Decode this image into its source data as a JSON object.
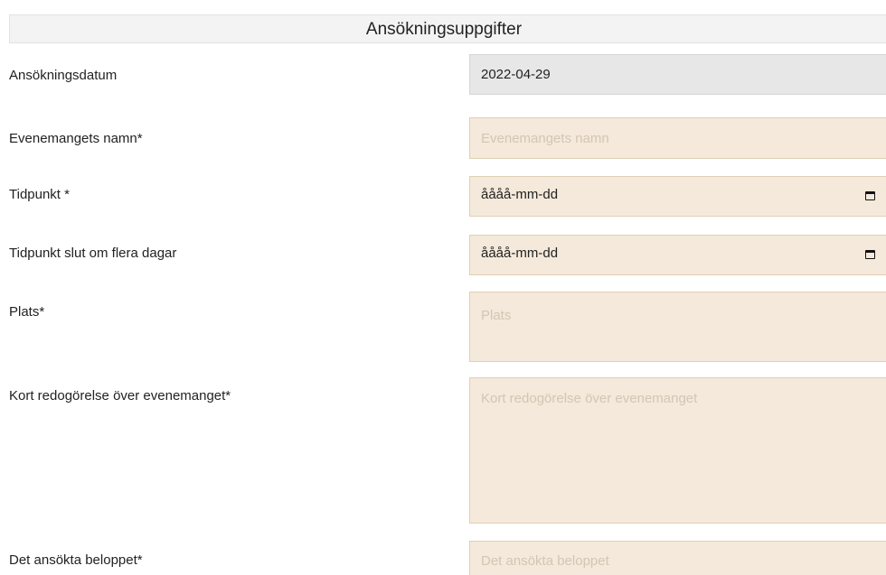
{
  "section": {
    "title": "Ansökningsuppgifter"
  },
  "fields": {
    "application_date": {
      "label": "Ansökningsdatum",
      "value": "2022-04-29"
    },
    "event_name": {
      "label": "Evenemangets namn*",
      "placeholder": "Evenemangets namn"
    },
    "start_time": {
      "label": "Tidpunkt *",
      "value": "åååå-mm-dd",
      "icon": "calendar-icon"
    },
    "end_time": {
      "label": "Tidpunkt slut om flera dagar",
      "value": "åååå-mm-dd",
      "icon": "calendar-icon"
    },
    "place": {
      "label": "Plats*",
      "placeholder": "Plats"
    },
    "description": {
      "label": "Kort redogörelse över evenemanget*",
      "placeholder": "Kort redogörelse över evenemanget"
    },
    "amount": {
      "label": "Det ansökta beloppet*",
      "placeholder": "Det ansökta beloppet"
    }
  },
  "colors": {
    "field_background": "#f4e9da",
    "readonly_background": "#e7e7e7",
    "placeholder_text": "#d3c6b4"
  }
}
